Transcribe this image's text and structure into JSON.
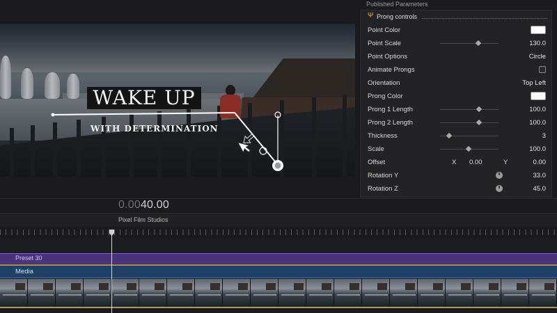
{
  "viewer": {
    "title_text": "WAKE UP",
    "subtitle_text": "WITH DETERMINATION"
  },
  "inspector": {
    "header": "Published Parameters",
    "group": {
      "icon": "trident-icon",
      "label": "Prong controls"
    },
    "params": [
      {
        "label": "Point Color",
        "type": "color",
        "value": "#ffffff"
      },
      {
        "label": "Point Scale",
        "type": "slider",
        "value": "130.0",
        "level": 0.65
      },
      {
        "label": "Point Options",
        "type": "text",
        "value": "Circle"
      },
      {
        "label": "Animate Prongs",
        "type": "checkbox",
        "checked": false
      },
      {
        "label": "Orientation",
        "type": "text",
        "value": "Top Left"
      },
      {
        "label": "Prong Color",
        "type": "color",
        "value": "#ffffff"
      },
      {
        "label": "Prong 1 Length",
        "type": "slider",
        "value": "100.0",
        "level": 0.67
      },
      {
        "label": "Prong 2 Length",
        "type": "slider",
        "value": "100.0",
        "level": 0.67
      },
      {
        "label": "Thickness",
        "type": "slider",
        "value": "3",
        "level": 0.15
      },
      {
        "label": "Scale",
        "type": "slider",
        "value": "100.0",
        "level": 0.49
      },
      {
        "label": "Offset",
        "type": "xy",
        "x_label": "X",
        "x_value": "0.00",
        "y_label": "Y",
        "y_value": "0.00"
      },
      {
        "label": "Rotation Y",
        "type": "dial",
        "value": "33.0"
      },
      {
        "label": "Rotation Z",
        "type": "dial",
        "value": "45.0"
      }
    ]
  },
  "timecode": {
    "dim": "0.00",
    "bright": "40.00"
  },
  "timeline": {
    "project_name": "Pixel Film Studios",
    "title_clip": "Preset 30",
    "media_clip": "Media",
    "colors": {
      "title_clip": "#46337a",
      "media_clip": "#1f3f66",
      "audio_line": "#b99a2c"
    }
  }
}
